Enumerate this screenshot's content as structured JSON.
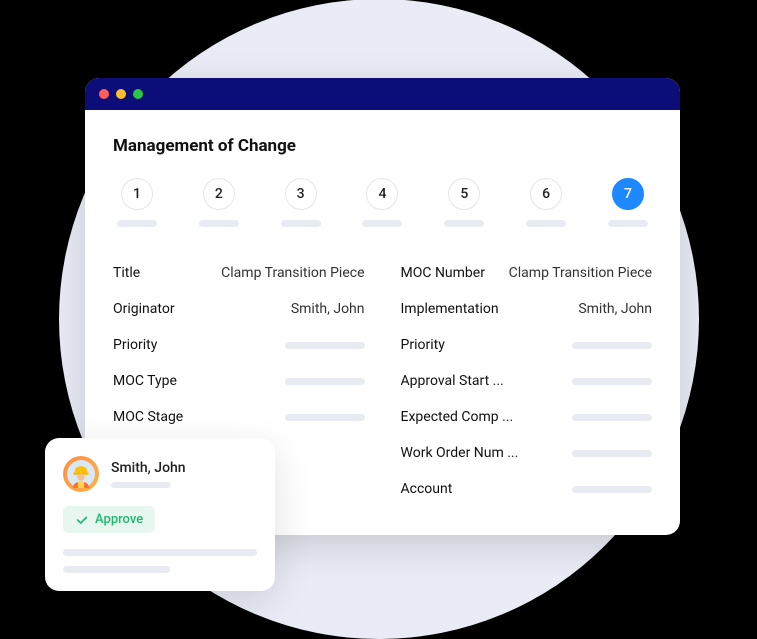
{
  "page_title": "Management of Change",
  "stepper": {
    "steps": [
      "1",
      "2",
      "3",
      "4",
      "5",
      "6",
      "7"
    ],
    "active_index": 6
  },
  "fields_left": [
    {
      "label": "Title",
      "value": "Clamp Transition Piece",
      "has_value": true
    },
    {
      "label": "Originator",
      "value": "Smith, John",
      "has_value": true
    },
    {
      "label": "Priority",
      "value": "",
      "has_value": false
    },
    {
      "label": "MOC Type",
      "value": "",
      "has_value": false
    },
    {
      "label": "MOC Stage",
      "value": "",
      "has_value": false
    }
  ],
  "fields_right": [
    {
      "label": "MOC Number",
      "value": "Clamp Transition Piece",
      "has_value": true
    },
    {
      "label": "Implementation",
      "value": "Smith, John",
      "has_value": true
    },
    {
      "label": "Priority",
      "value": "",
      "has_value": false
    },
    {
      "label": "Approval Start ...",
      "value": "",
      "has_value": false
    },
    {
      "label": "Expected Comp ...",
      "value": "",
      "has_value": false
    },
    {
      "label": "Work Order Num ...",
      "value": "",
      "has_value": false
    },
    {
      "label": "Account",
      "value": "",
      "has_value": false
    }
  ],
  "user_card": {
    "name": "Smith, John",
    "approve_label": "Approve"
  },
  "colors": {
    "titlebar": "#0d0d7a",
    "accent": "#1e88ff",
    "approve": "#1fb871"
  }
}
